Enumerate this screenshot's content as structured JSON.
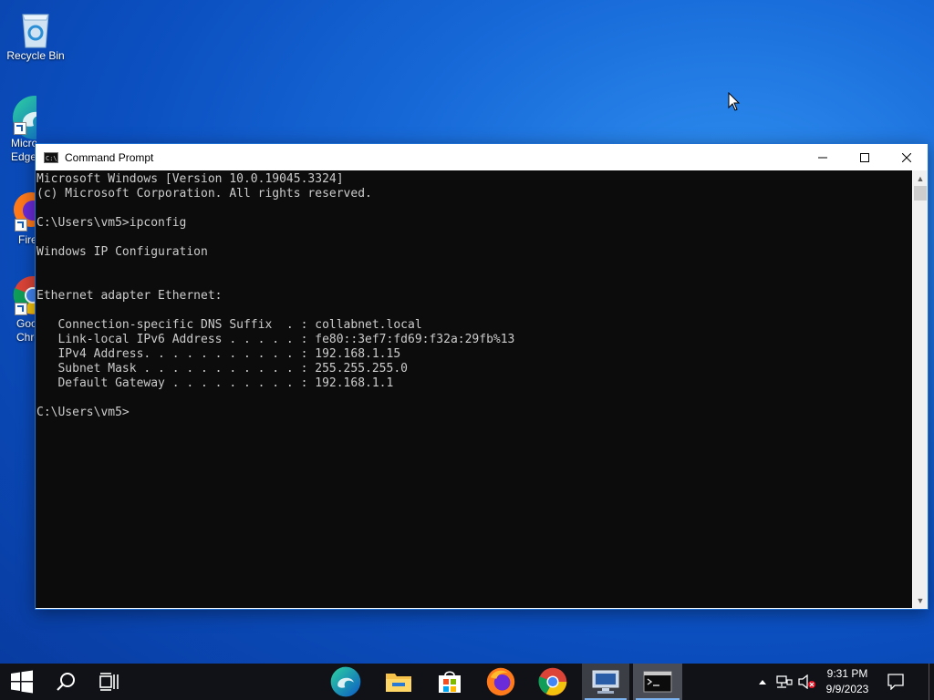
{
  "desktop": {
    "icons": [
      {
        "label": "Recycle Bin",
        "icon": "recycle-bin-icon"
      },
      {
        "label": "Microsoft Edge",
        "icon": "edge-icon"
      },
      {
        "label": "Firefox",
        "icon": "firefox-icon"
      },
      {
        "label": "Google Chrome",
        "icon": "chrome-icon"
      }
    ]
  },
  "window": {
    "title": "Command Prompt",
    "minimize_icon": "minimize-icon",
    "maximize_icon": "maximize-icon",
    "close_icon": "close-icon"
  },
  "console": {
    "lines": [
      "Microsoft Windows [Version 10.0.19045.3324]",
      "(c) Microsoft Corporation. All rights reserved.",
      "",
      "C:\\Users\\vm5>ipconfig",
      "",
      "Windows IP Configuration",
      "",
      "",
      "Ethernet adapter Ethernet:",
      "",
      "   Connection-specific DNS Suffix  . : collabnet.local",
      "   Link-local IPv6 Address . . . . . : fe80::3ef7:fd69:f32a:29fb%13",
      "   IPv4 Address. . . . . . . . . . . : 192.168.1.15",
      "   Subnet Mask . . . . . . . . . . . : 255.255.255.0",
      "   Default Gateway . . . . . . . . . : 192.168.1.1",
      "",
      "C:\\Users\\vm5>"
    ]
  },
  "taskbar": {
    "start_icon": "windows-start-icon",
    "search_icon": "search-icon",
    "task_view_icon": "task-view-icon",
    "pinned": [
      "edge-icon",
      "file-explorer-icon",
      "microsoft-store-icon",
      "firefox-icon",
      "chrome-icon",
      "network-connections-icon",
      "command-prompt-icon"
    ],
    "time": "9:31 PM",
    "date": "9/9/2023"
  },
  "colors": {
    "console_bg": "#0c0c0c",
    "console_fg": "#cccccc",
    "taskbar_bg": "#101217",
    "accent": "#1f6fd0"
  }
}
